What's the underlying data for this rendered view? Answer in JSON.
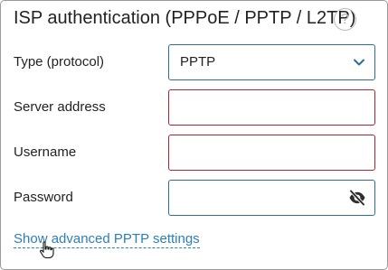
{
  "panel": {
    "title": "ISP authentication (PPPoE / PPTP / L2TP)",
    "help_icon": "question-circle-icon",
    "help_glyph": "?"
  },
  "form": {
    "type": {
      "label": "Type (protocol)",
      "value": "PPTP",
      "icon": "chevron-down-icon"
    },
    "server": {
      "label": "Server address",
      "value": ""
    },
    "username": {
      "label": "Username",
      "value": ""
    },
    "password": {
      "label": "Password",
      "value": "",
      "icon": "eye-off-icon"
    }
  },
  "advanced_link": "Show advanced PPTP settings",
  "colors": {
    "accent": "#2b6f97",
    "error": "#b5212d",
    "link": "#2b7fb8"
  }
}
